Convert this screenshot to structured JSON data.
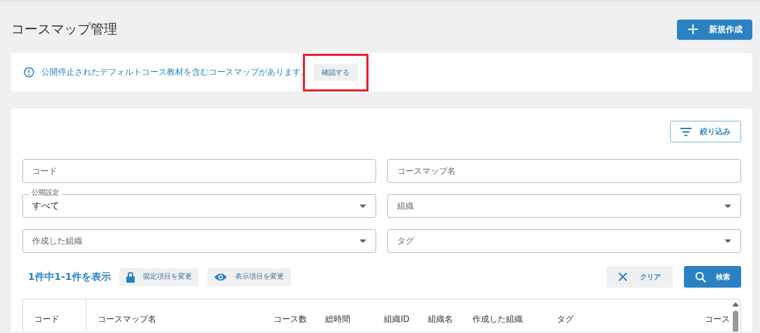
{
  "page": {
    "title": "コースマップ管理",
    "create_button": "新規作成"
  },
  "alert": {
    "message": "公開停止されたデフォルトコース教材を含むコースマップがあります。",
    "button": "確認する",
    "highlighted": true
  },
  "filters": {
    "toggle_button": "絞り込み",
    "fields": [
      {
        "kind": "text",
        "placeholder": "コード"
      },
      {
        "kind": "text",
        "placeholder": "コースマップ名"
      },
      {
        "kind": "select",
        "label": "公開設定",
        "value": "すべて"
      },
      {
        "kind": "select",
        "placeholder": "組織"
      },
      {
        "kind": "select",
        "placeholder": "作成した組織"
      },
      {
        "kind": "select",
        "placeholder": "タグ"
      }
    ]
  },
  "results": {
    "count": "1件中1-1件を表示",
    "fixed_columns_button": "固定項目を変更",
    "visible_columns_button": "表示項目を変更",
    "clear_button": "クリア",
    "search_button": "検索"
  },
  "table": {
    "columns": [
      "コード",
      "コースマップ名",
      "コース数",
      "総時間",
      "組織ID",
      "組織名",
      "作成した組織",
      "タグ",
      "コース"
    ]
  }
}
